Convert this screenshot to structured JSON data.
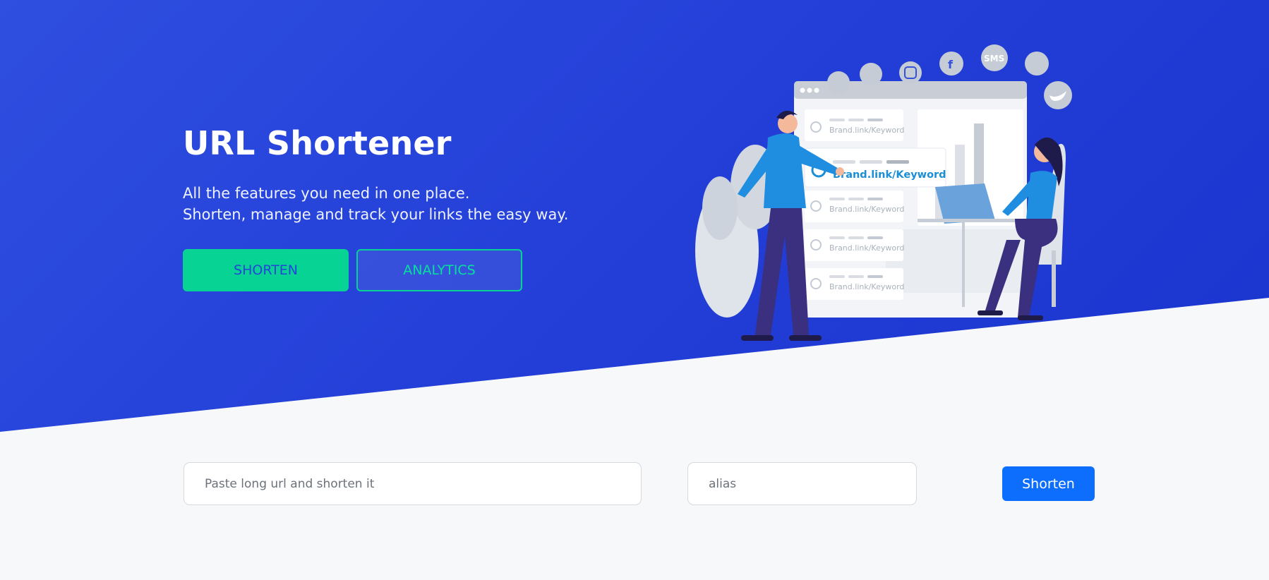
{
  "hero": {
    "title": "URL Shortener",
    "subtitle_line1": "All the features you need in one place.",
    "subtitle_line2": "Shorten, manage and track your links the easy way.",
    "buttons": {
      "shorten": "SHORTEN",
      "analytics": "ANALYTICS"
    },
    "gradient": [
      "#2f4fe0",
      "#1a35cf"
    ],
    "accent": "#06d394"
  },
  "illustration": {
    "link_text": "Brand.link/Keyword",
    "channel_sms": "SMS",
    "channel_icons": [
      "chat-icon",
      "mail-icon",
      "instagram-icon",
      "facebook-icon",
      "sms-icon",
      "qr-code-icon",
      "twitter-icon"
    ]
  },
  "form": {
    "url_placeholder": "Paste long url and shorten it",
    "alias_placeholder": "alias",
    "submit_label": "Shorten",
    "submit_color": "#0d6efd"
  }
}
